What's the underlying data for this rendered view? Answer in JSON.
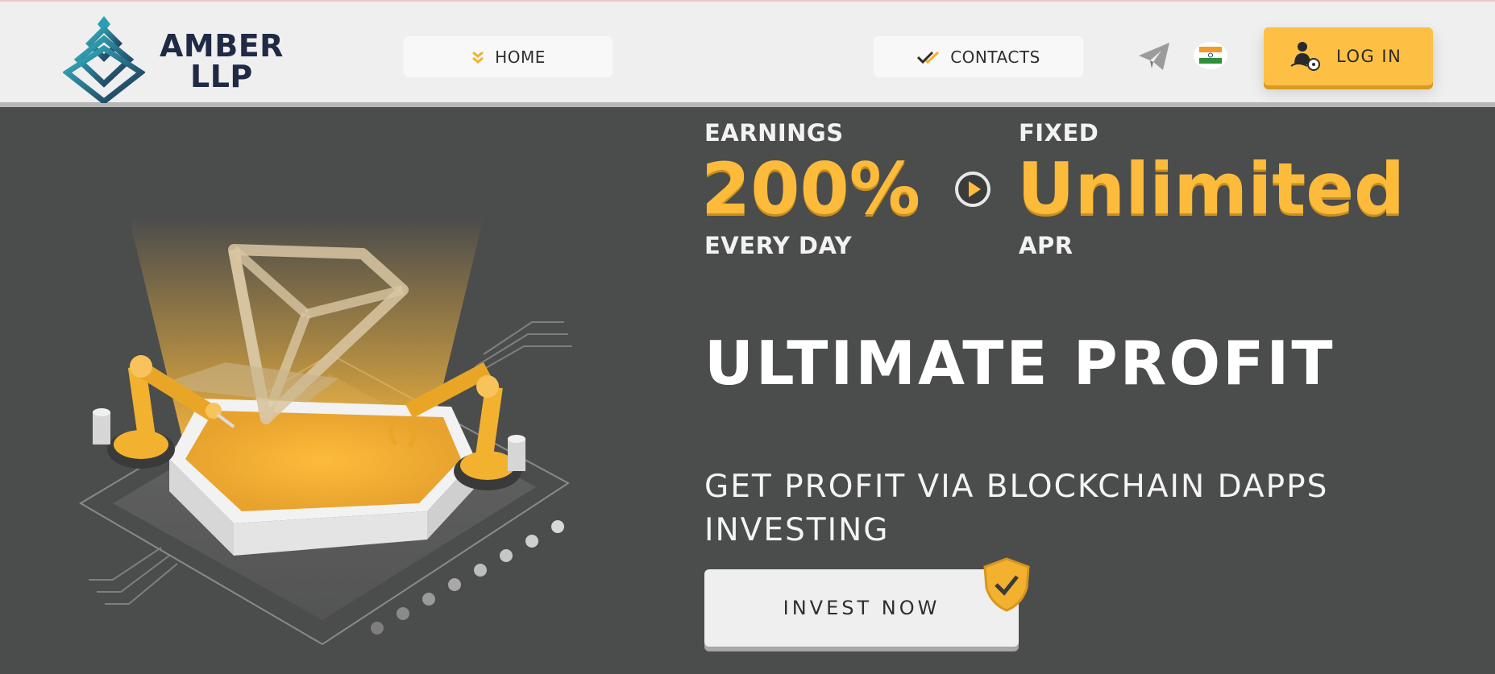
{
  "logo": {
    "line1": "AMBER",
    "line2": "LLP",
    "icon": "diamond-pyramid-logo"
  },
  "nav": {
    "home": {
      "label": "HOME",
      "icon": "double-chevron-down-icon"
    },
    "contacts": {
      "label": "CONTACTS",
      "icon": "double-check-icon"
    }
  },
  "header_icons": {
    "telegram": "telegram-icon",
    "language": "india-flag-icon"
  },
  "login": {
    "label": "LOG IN",
    "icon": "user-key-icon"
  },
  "stats": {
    "left_top": "EARNINGS",
    "left_value": "200%",
    "left_bottom": "EVERY DAY",
    "right_top": "FIXED",
    "right_value": "Unlimited",
    "right_bottom": "APR"
  },
  "hero": {
    "headline": "ULTIMATE PROFIT",
    "subline": "GET PROFIT VIA BLOCKCHAIN DAPPS INVESTING",
    "cta_label": "INVEST NOW"
  },
  "colors": {
    "accent": "#fdbb3b",
    "background": "#4b4c4c",
    "header_bg": "#efefef",
    "logo_blue": "#1f2a44",
    "logo_teal": "#2a9fb3"
  }
}
